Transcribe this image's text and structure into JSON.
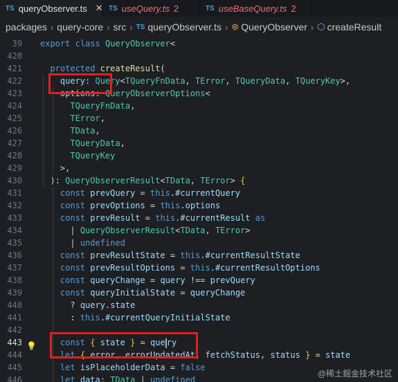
{
  "tabs": [
    {
      "lang": "TS",
      "name": "queryObserver.ts",
      "close": "✕"
    },
    {
      "lang": "TS",
      "name": "useQuery.ts",
      "badge": "2"
    },
    {
      "lang": "TS",
      "name": "useBaseQuery.ts",
      "badge": "2"
    }
  ],
  "breadcrumb": {
    "items": [
      "packages",
      "query-core",
      "src",
      "queryObserver.ts",
      "QueryObserver",
      "createResult"
    ],
    "file_lang": "TS"
  },
  "code": {
    "lines": [
      {
        "n": "39",
        "text": "export class QueryObserver<"
      },
      {
        "n": "420",
        "text": ""
      },
      {
        "n": "421",
        "text": "  protected createResult("
      },
      {
        "n": "422",
        "text": "    query: Query<TQueryFnData, TError, TQueryData, TQueryKey>,"
      },
      {
        "n": "423",
        "text": "    options: QueryObserverOptions<"
      },
      {
        "n": "424",
        "text": "      TQueryFnData,"
      },
      {
        "n": "425",
        "text": "      TError,"
      },
      {
        "n": "426",
        "text": "      TData,"
      },
      {
        "n": "427",
        "text": "      TQueryData,"
      },
      {
        "n": "428",
        "text": "      TQueryKey"
      },
      {
        "n": "429",
        "text": "    >,"
      },
      {
        "n": "430",
        "text": "  ): QueryObserverResult<TData, TError> {"
      },
      {
        "n": "431",
        "text": "    const prevQuery = this.#currentQuery"
      },
      {
        "n": "432",
        "text": "    const prevOptions = this.options"
      },
      {
        "n": "433",
        "text": "    const prevResult = this.#currentResult as"
      },
      {
        "n": "434",
        "text": "      | QueryObserverResult<TData, TError>"
      },
      {
        "n": "435",
        "text": "      | undefined"
      },
      {
        "n": "436",
        "text": "    const prevResultState = this.#currentResultState"
      },
      {
        "n": "437",
        "text": "    const prevResultOptions = this.#currentResultOptions"
      },
      {
        "n": "438",
        "text": "    const queryChange = query !== prevQuery"
      },
      {
        "n": "439",
        "text": "    const queryInitialState = queryChange"
      },
      {
        "n": "440",
        "text": "      ? query.state"
      },
      {
        "n": "441",
        "text": "      : this.#currentQueryInitialState"
      },
      {
        "n": "442",
        "text": ""
      },
      {
        "n": "443",
        "text": "    const { state } = query"
      },
      {
        "n": "444",
        "text": "    let { error, errorUpdatedAt, fetchStatus, status } = state"
      },
      {
        "n": "445",
        "text": "    let isPlaceholderData = false"
      },
      {
        "n": "446",
        "text": "    let data: TData | undefined"
      }
    ],
    "current_line": "443"
  },
  "watermark": "@稀土掘金技术社区",
  "colors": {
    "highlight_box": "#e02020",
    "background": "#1e1f22"
  }
}
